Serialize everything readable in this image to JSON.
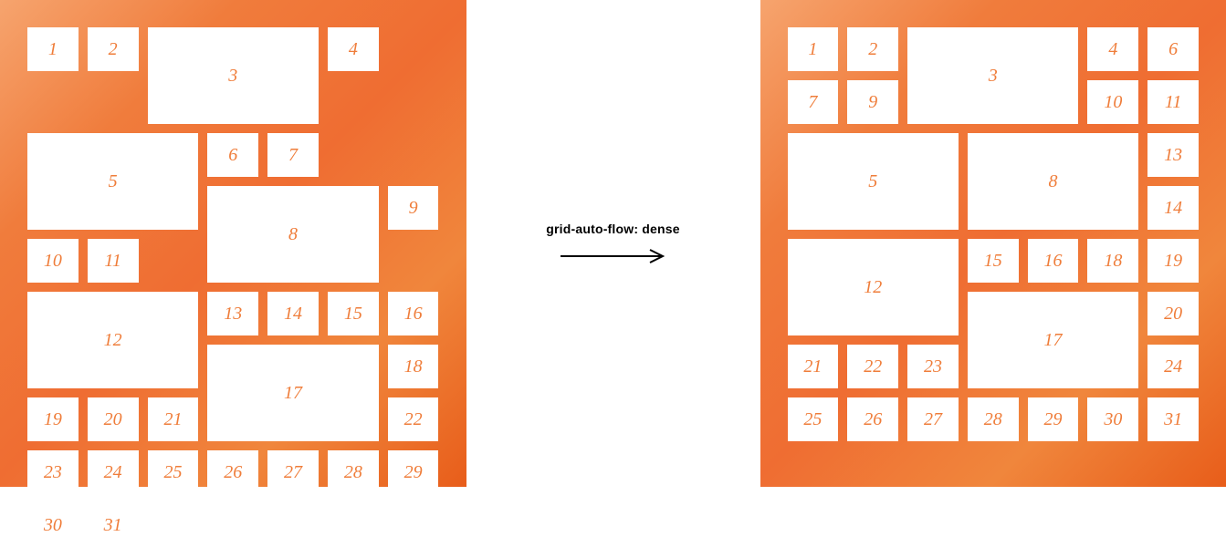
{
  "label": "grid-auto-flow: dense",
  "items": [
    {
      "n": 1,
      "w": 1,
      "h": 1
    },
    {
      "n": 2,
      "w": 1,
      "h": 1
    },
    {
      "n": 3,
      "w": 3,
      "h": 2
    },
    {
      "n": 4,
      "w": 1,
      "h": 1
    },
    {
      "n": 5,
      "w": 3,
      "h": 2
    },
    {
      "n": 6,
      "w": 1,
      "h": 1
    },
    {
      "n": 7,
      "w": 1,
      "h": 1
    },
    {
      "n": 8,
      "w": 3,
      "h": 2
    },
    {
      "n": 9,
      "w": 1,
      "h": 1
    },
    {
      "n": 10,
      "w": 1,
      "h": 1
    },
    {
      "n": 11,
      "w": 1,
      "h": 1
    },
    {
      "n": 12,
      "w": 3,
      "h": 2
    },
    {
      "n": 13,
      "w": 1,
      "h": 1
    },
    {
      "n": 14,
      "w": 1,
      "h": 1
    },
    {
      "n": 15,
      "w": 1,
      "h": 1
    },
    {
      "n": 16,
      "w": 1,
      "h": 1
    },
    {
      "n": 17,
      "w": 3,
      "h": 2
    },
    {
      "n": 18,
      "w": 1,
      "h": 1
    },
    {
      "n": 19,
      "w": 1,
      "h": 1
    },
    {
      "n": 20,
      "w": 1,
      "h": 1
    },
    {
      "n": 21,
      "w": 1,
      "h": 1
    },
    {
      "n": 22,
      "w": 1,
      "h": 1
    },
    {
      "n": 23,
      "w": 1,
      "h": 1
    },
    {
      "n": 24,
      "w": 1,
      "h": 1
    },
    {
      "n": 25,
      "w": 1,
      "h": 1
    },
    {
      "n": 26,
      "w": 1,
      "h": 1
    },
    {
      "n": 27,
      "w": 1,
      "h": 1
    },
    {
      "n": 28,
      "w": 1,
      "h": 1
    },
    {
      "n": 29,
      "w": 1,
      "h": 1
    },
    {
      "n": 30,
      "w": 1,
      "h": 1
    },
    {
      "n": 31,
      "w": 1,
      "h": 1
    }
  ]
}
